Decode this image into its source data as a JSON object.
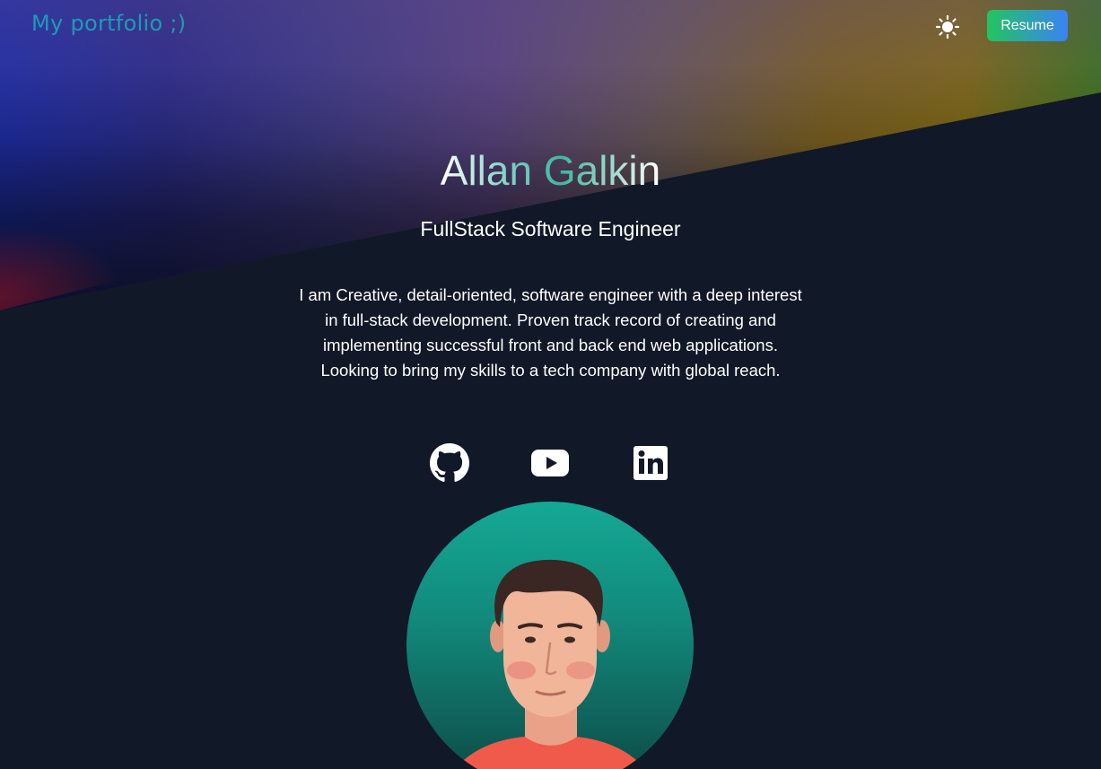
{
  "header": {
    "logo_text": "My portfolio ;)",
    "theme_icon": "sun-icon",
    "resume_label": "Resume"
  },
  "hero": {
    "name": "Allan Galkin",
    "role": "FullStack Software Engineer",
    "bio": "I am Creative, detail-oriented, software engineer with a deep interest in full-stack development. Proven track record of creating and implementing successful front and back end web applications. Looking to bring my skills to a tech company with global reach."
  },
  "socials": [
    {
      "name": "GitHub",
      "icon": "github-icon"
    },
    {
      "name": "YouTube",
      "icon": "youtube-icon"
    },
    {
      "name": "LinkedIn",
      "icon": "linkedin-icon"
    }
  ],
  "colors": {
    "background": "#111827",
    "logo": "#1e9bb3",
    "resume_gradient_start": "#22c55e",
    "resume_gradient_end": "#3b82f6",
    "name_accent": "#3fb59f",
    "avatar_bg": "#14a995"
  }
}
